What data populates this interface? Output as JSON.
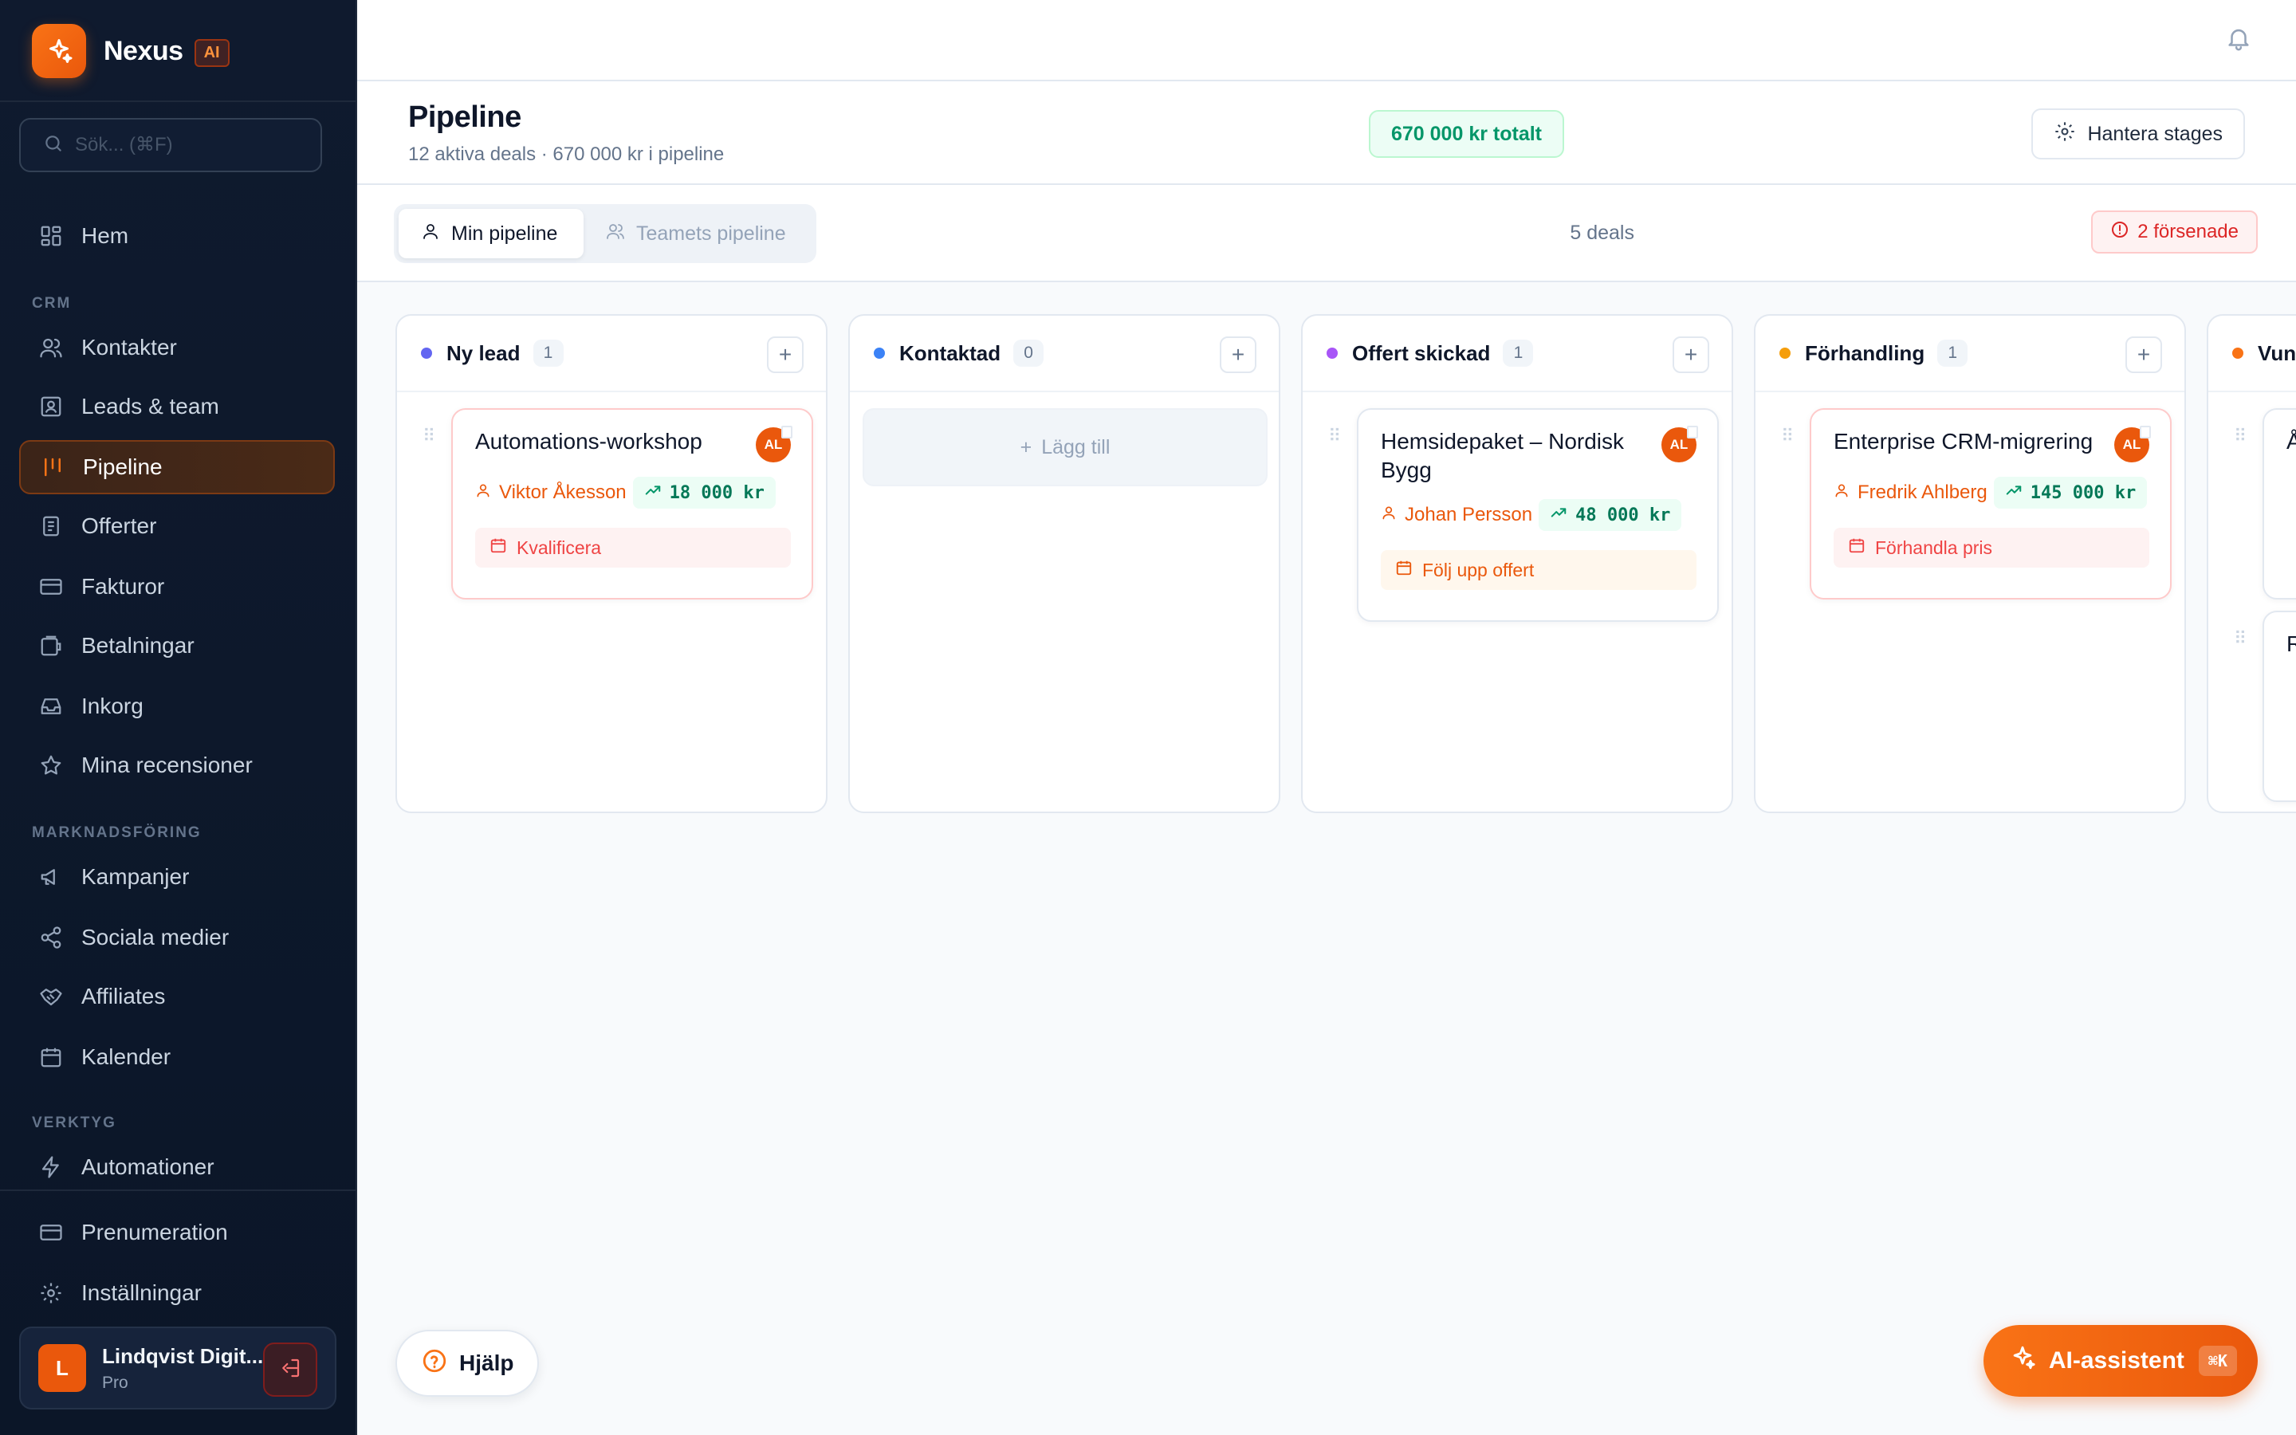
{
  "brand": {
    "name": "Nexus",
    "badge": "AI",
    "accent": "#f97316"
  },
  "search": {
    "placeholder": "Sök... (⌘F)"
  },
  "sidebar": {
    "items": [
      {
        "label": "Hem",
        "icon": "home-grid-icon"
      },
      {
        "label": "Kontakter",
        "icon": "users-icon"
      },
      {
        "label": "Leads & team",
        "icon": "contact-card-icon"
      },
      {
        "label": "Pipeline",
        "icon": "pipeline-icon",
        "active": true
      },
      {
        "label": "Offerter",
        "icon": "document-icon"
      },
      {
        "label": "Fakturor",
        "icon": "credit-card-icon"
      },
      {
        "label": "Betalningar",
        "icon": "wallet-icon"
      },
      {
        "label": "Inkorg",
        "icon": "inbox-icon"
      },
      {
        "label": "Mina recensioner",
        "icon": "star-icon"
      },
      {
        "label": "Kampanjer",
        "icon": "megaphone-icon"
      },
      {
        "label": "Sociala medier",
        "icon": "share-icon"
      },
      {
        "label": "Affiliates",
        "icon": "handshake-icon"
      },
      {
        "label": "Kalender",
        "icon": "calendar-icon"
      },
      {
        "label": "Automationer",
        "icon": "lightning-icon"
      },
      {
        "label": "Prenumeration",
        "icon": "credit-card-icon"
      },
      {
        "label": "Inställningar",
        "icon": "gear-icon"
      }
    ],
    "sections": {
      "crm": "CRM",
      "marketing": "MARKNADSFÖRING",
      "tools": "VERKTYG"
    }
  },
  "user": {
    "initial": "L",
    "name": "Lindqvist Digit...",
    "plan": "Pro"
  },
  "header": {
    "title": "Pipeline",
    "subtitle": "12 aktiva deals · 670 000 kr i pipeline",
    "total": "670 000 kr totalt",
    "manage_label": "Hantera stages"
  },
  "tabs": {
    "mine": "Min pipeline",
    "team": "Teamets pipeline"
  },
  "status": {
    "deals": "5 deals",
    "overdue": "2 försenade"
  },
  "columns": [
    {
      "title": "Ny lead",
      "count": "1",
      "color": "#6366f1"
    },
    {
      "title": "Kontaktad",
      "count": "0",
      "color": "#3b82f6"
    },
    {
      "title": "Offert skickad",
      "count": "1",
      "color": "#a855f7"
    },
    {
      "title": "Förhandling",
      "count": "1",
      "color": "#f59e0b"
    },
    {
      "title": "Vunn",
      "count": "",
      "color": "#f97316"
    }
  ],
  "add_placeholder": "Lägg till",
  "cards": [
    {
      "title": "Automations-workshop",
      "avatar": "AL",
      "contact": "Viktor Åkesson",
      "amount": "18 000 kr",
      "task": "Kvalificera"
    },
    {
      "title": "Hemsidepaket – Nordisk Bygg",
      "avatar": "AL",
      "contact": "Johan Persson",
      "amount": "48 000 kr",
      "task": "Följ upp offert"
    },
    {
      "title": "Enterprise CRM-migrering",
      "avatar": "AL",
      "contact": "Fredrik Ahlberg",
      "amount": "145 000 kr",
      "task": "Förhandla pris"
    },
    {
      "title": "Å",
      "contact": ""
    },
    {
      "title": "R",
      "contact": ""
    }
  ],
  "help": {
    "label": "Hjälp"
  },
  "ai": {
    "label": "AI-assistent",
    "shortcut": "⌘K"
  }
}
